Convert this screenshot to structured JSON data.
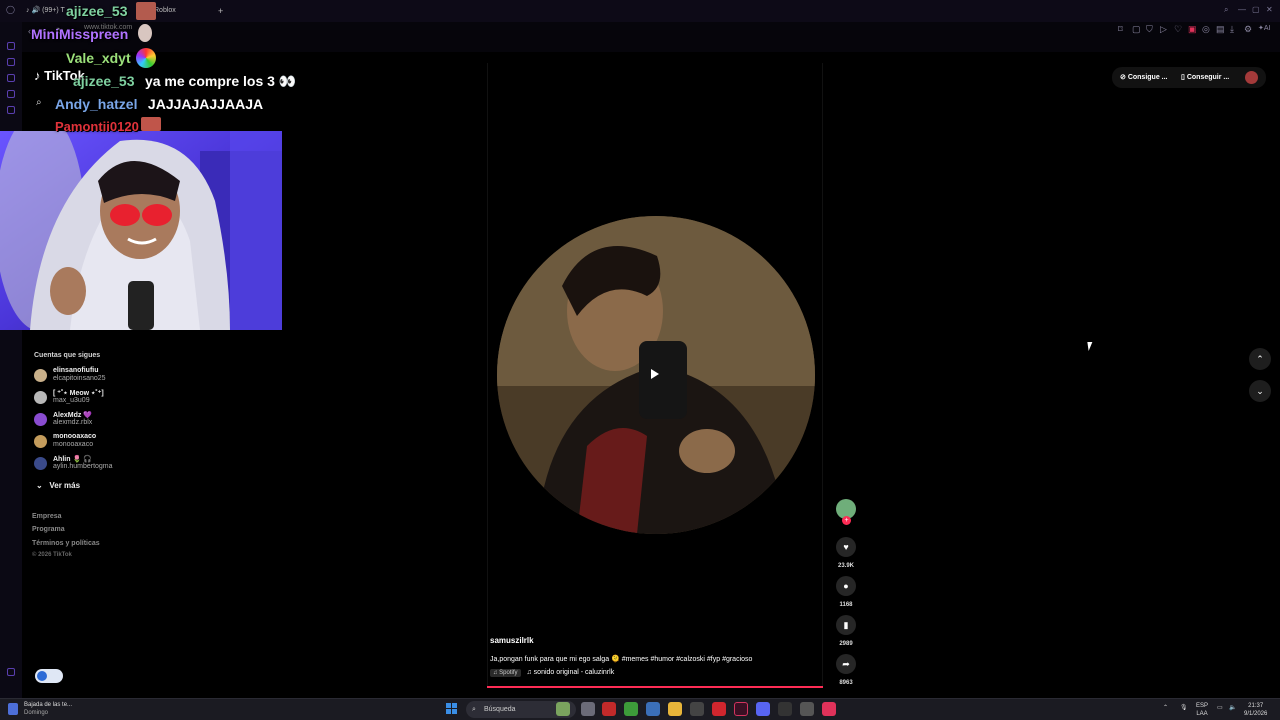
{
  "browser": {
    "tab_count": "(99+) T",
    "tab_roblox": "Roblox",
    "url": "www.tiktok.com",
    "new_tab": "+"
  },
  "tiktok": {
    "logo": "TikTok",
    "following_title": "Cuentas que sigues",
    "accounts": [
      {
        "display": "elinsanofiufiu",
        "handle": "elcapitoinsano25",
        "color": "#c9b08a"
      },
      {
        "display": "[ ⁺˚⋆ Meow ⋆˚⁺]",
        "handle": "max_u3u09",
        "color": "#b8b8b8"
      },
      {
        "display": "AlexMdz 💜",
        "handle": "alexmdz.rblx",
        "color": "#8a4cd0"
      },
      {
        "display": "monooaxaco",
        "handle": "monooaxaco",
        "color": "#c49c5c"
      },
      {
        "display": "Ahlin 🌷 🎧",
        "handle": "aylin.humbertogma",
        "color": "#3a4a8a"
      }
    ],
    "see_more": "Ver más",
    "footer": [
      "Empresa",
      "Programa",
      "Términos y políticas",
      "© 2026 TikTok"
    ],
    "top_buttons": [
      "Consigue ...",
      "Conseguir ..."
    ]
  },
  "chat": [
    {
      "name": "ajizee_53",
      "color": "#7fd1a0",
      "msg": ""
    },
    {
      "name": "MiniMisspreen",
      "color": "#b072ff",
      "msg": ""
    },
    {
      "name": "Vale_xdyt",
      "color": "#9be07a",
      "msg": ""
    },
    {
      "name": "ajizee_53",
      "color": "#7fd1a0",
      "msg": "ya me compre los 3 👀"
    },
    {
      "name": "Andy_hatzel",
      "color": "#7aa6e8",
      "msg": "JAJJAJAJJAAJA"
    },
    {
      "name": "Pamontii0120",
      "color": "#e0323a",
      "msg": ""
    }
  ],
  "video": {
    "username": "samuszilrlk",
    "description": "Ja,pongan funk para que mi ego salga 🫠 #memes #humor #calzoski #fyp #gracioso",
    "music_source": "Spotify",
    "music": "sonido original - caluzinrlk",
    "likes": "23.9K",
    "comments": "1168",
    "saves": "2989",
    "shares": "8963"
  },
  "taskbar": {
    "weather_line1": "Bajada de las te...",
    "weather_line2": "Domingo",
    "search_placeholder": "Búsqueda",
    "lang1": "ESP",
    "lang2": "LAA",
    "time": "21:37",
    "date": "9/1/2026"
  }
}
